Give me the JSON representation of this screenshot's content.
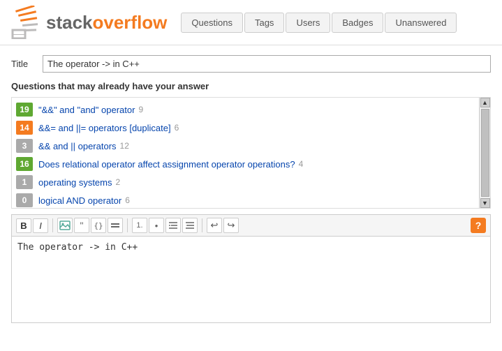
{
  "header": {
    "logo_text_plain": "stack",
    "logo_text_bold": "overflow",
    "nav": {
      "items": [
        {
          "label": "Questions",
          "active": false
        },
        {
          "label": "Tags",
          "active": false
        },
        {
          "label": "Users",
          "active": false
        },
        {
          "label": "Badges",
          "active": false
        },
        {
          "label": "Unanswered",
          "active": false
        }
      ]
    }
  },
  "title_section": {
    "label": "Title",
    "input_value": "The operator -> in C++"
  },
  "similar_section": {
    "heading": "Questions that may already have your answer",
    "items": [
      {
        "votes": "19",
        "badge_color": "green",
        "link": "\"&&\" and \"and\" operator",
        "count": "9"
      },
      {
        "votes": "14",
        "badge_color": "orange",
        "link": "&&= and ||= operators [duplicate]",
        "count": "6"
      },
      {
        "votes": "3",
        "badge_color": "gray",
        "link": "&& and || operators",
        "count": "12"
      },
      {
        "votes": "16",
        "badge_color": "green",
        "link": "Does relational operator affect assignment operator operations?",
        "count": "4"
      },
      {
        "votes": "1",
        "badge_color": "gray",
        "link": "operating systems",
        "count": "2"
      },
      {
        "votes": "0",
        "badge_color": "gray",
        "link": "logical AND operator",
        "count": "6"
      }
    ]
  },
  "editor": {
    "content": "The operator -> in C++\n",
    "toolbar": {
      "bold": "B",
      "italic": "I",
      "help": "?"
    }
  },
  "colors": {
    "accent": "#F47B20",
    "link": "#0645ad",
    "badge_green": "#5fa832",
    "badge_orange": "#F47B20",
    "badge_gray": "#aaa"
  }
}
